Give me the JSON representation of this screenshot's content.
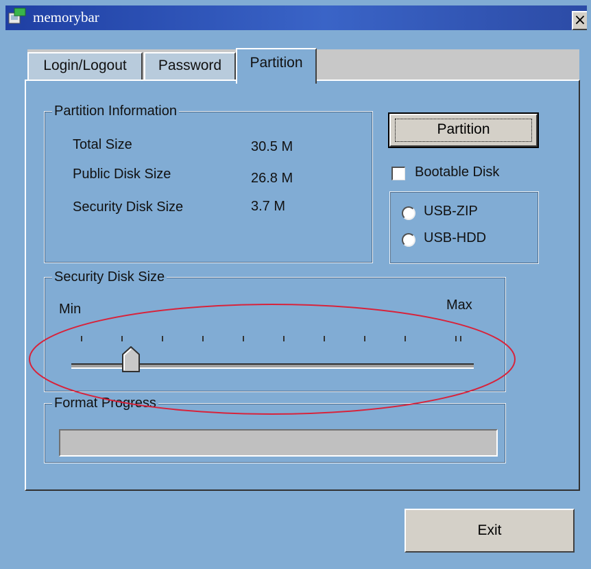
{
  "window": {
    "title": "memorybar",
    "close_glyph": "×"
  },
  "tabs": [
    {
      "label": "Login/Logout",
      "active": false
    },
    {
      "label": "Password",
      "active": false
    },
    {
      "label": "Partition",
      "active": true
    }
  ],
  "partition_info": {
    "legend": "Partition Information",
    "rows": [
      {
        "label": "Total Size",
        "value": "30.5 M"
      },
      {
        "label": "Public Disk Size",
        "value": "26.8 M"
      },
      {
        "label": "Security Disk Size",
        "value": "3.7 M"
      }
    ]
  },
  "partition_button": {
    "label": "Partition"
  },
  "bootable": {
    "label": "Bootable Disk",
    "checked": false
  },
  "usb_mode": {
    "options": [
      {
        "label": "USB-ZIP",
        "selected": false
      },
      {
        "label": "USB-HDD",
        "selected": false
      }
    ]
  },
  "security_slider": {
    "legend": "Security Disk Size",
    "min_label": "Min",
    "max_label": "Max",
    "tick_count": 11,
    "position_fraction": 0.14
  },
  "format_progress": {
    "legend": "Format Progress",
    "progress": 0
  },
  "exit_button": {
    "label": "Exit"
  },
  "colors": {
    "window_background": "#81acd4",
    "titlebar": "#2c4ba6",
    "annotation_ellipse": "#d8223a"
  },
  "icons": {
    "app": "memorybar-app-icon",
    "close": "close-icon",
    "slider_thumb": "slider-thumb-icon"
  }
}
